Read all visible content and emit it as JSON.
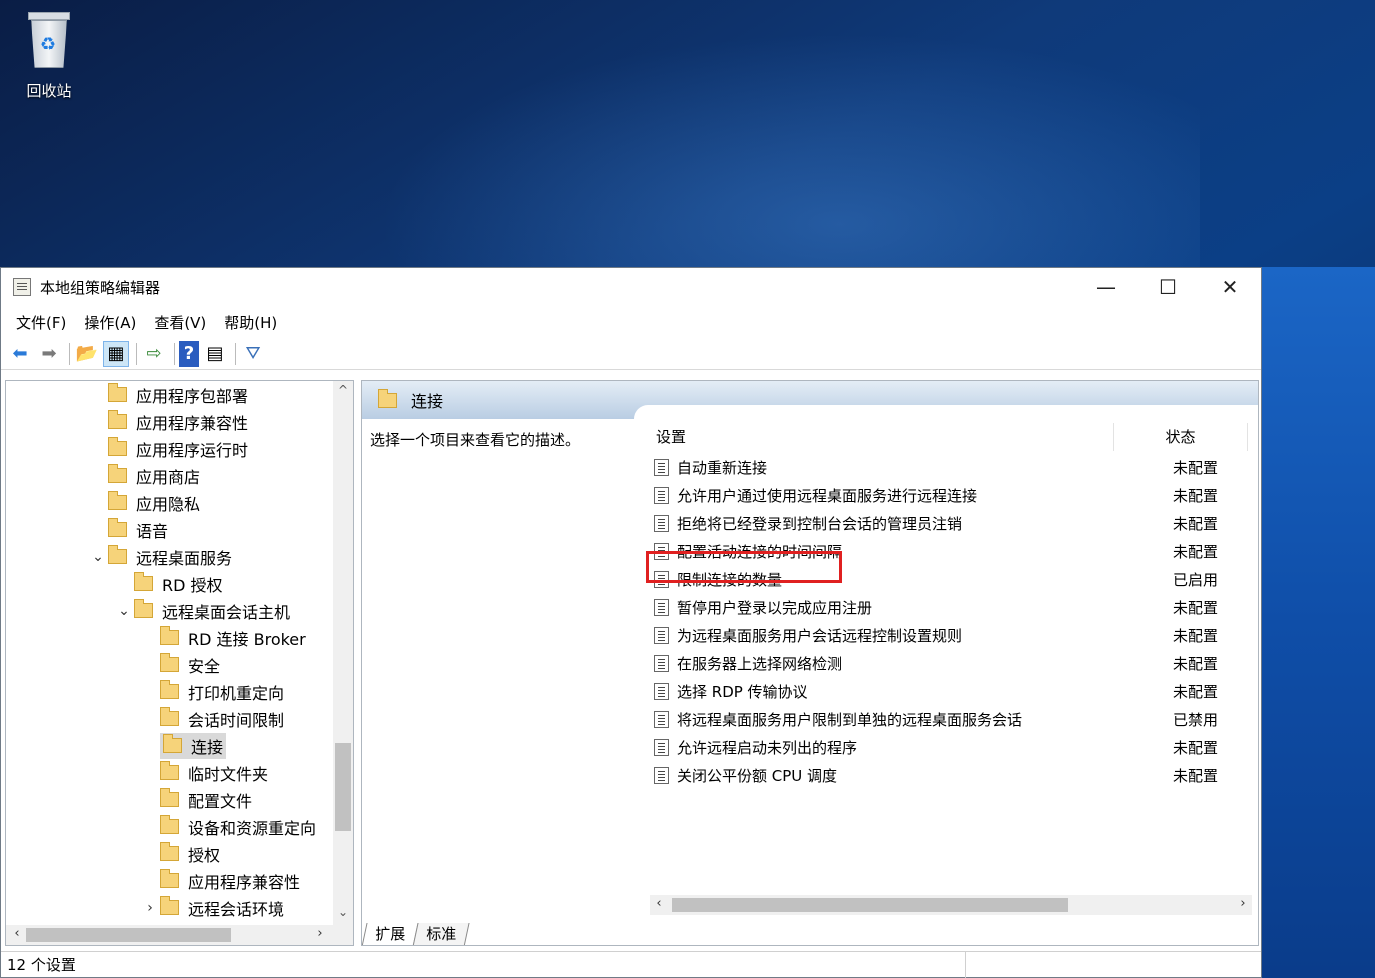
{
  "desktop": {
    "recycle_bin_label": "回收站"
  },
  "window": {
    "title": "本地组策略编辑器",
    "controls": {
      "minimize": "—",
      "maximize": "☐",
      "close": "✕"
    }
  },
  "menu": [
    "文件(F)",
    "操作(A)",
    "查看(V)",
    "帮助(H)"
  ],
  "toolbar": {
    "icons": [
      "back-arrow-icon",
      "forward-arrow-icon",
      "up-folder-icon",
      "show-hide-tree-icon",
      "export-list-icon",
      "help-icon",
      "properties-icon",
      "filter-icon"
    ],
    "glyphs": {
      "back": "⬅",
      "forward": "➡",
      "up": "📂",
      "tree": "▦",
      "export": "⇨",
      "help": "?",
      "view": "▤",
      "filter": "⛛"
    }
  },
  "tree": {
    "items": [
      {
        "label": "应用程序包部署",
        "level": 0,
        "expander": ""
      },
      {
        "label": "应用程序兼容性",
        "level": 0,
        "expander": ""
      },
      {
        "label": "应用程序运行时",
        "level": 0,
        "expander": ""
      },
      {
        "label": "应用商店",
        "level": 0,
        "expander": ""
      },
      {
        "label": "应用隐私",
        "level": 0,
        "expander": ""
      },
      {
        "label": "语音",
        "level": 0,
        "expander": ""
      },
      {
        "label": "远程桌面服务",
        "level": 0,
        "expander": "⌄"
      },
      {
        "label": "RD 授权",
        "level": 1,
        "expander": ""
      },
      {
        "label": "远程桌面会话主机",
        "level": 1,
        "expander": "⌄"
      },
      {
        "label": "RD 连接 Broker",
        "level": 2,
        "expander": ""
      },
      {
        "label": "安全",
        "level": 2,
        "expander": ""
      },
      {
        "label": "打印机重定向",
        "level": 2,
        "expander": ""
      },
      {
        "label": "会话时间限制",
        "level": 2,
        "expander": ""
      },
      {
        "label": "连接",
        "level": 2,
        "expander": "",
        "selected": true
      },
      {
        "label": "临时文件夹",
        "level": 2,
        "expander": ""
      },
      {
        "label": "配置文件",
        "level": 2,
        "expander": ""
      },
      {
        "label": "设备和资源重定向",
        "level": 2,
        "expander": ""
      },
      {
        "label": "授权",
        "level": 2,
        "expander": ""
      },
      {
        "label": "应用程序兼容性",
        "level": 2,
        "expander": ""
      },
      {
        "label": "远程会话环境",
        "level": 2,
        "expander": "›"
      }
    ],
    "scroll": {
      "up": "^",
      "down": "⌄",
      "left": "‹",
      "right": "›"
    }
  },
  "details": {
    "header": "连接",
    "description": "选择一个项目来查看它的描述。",
    "columns": {
      "setting": "设置",
      "state": "状态"
    },
    "rows": [
      {
        "name": "自动重新连接",
        "state": "未配置"
      },
      {
        "name": "允许用户通过使用远程桌面服务进行远程连接",
        "state": "未配置"
      },
      {
        "name": "拒绝将已经登录到控制台会话的管理员注销",
        "state": "未配置"
      },
      {
        "name": "配置活动连接的时间间隔",
        "state": "未配置"
      },
      {
        "name": "限制连接的数量",
        "state": "已启用",
        "highlighted": true
      },
      {
        "name": "暂停用户登录以完成应用注册",
        "state": "未配置"
      },
      {
        "name": "为远程桌面服务用户会话远程控制设置规则",
        "state": "未配置"
      },
      {
        "name": "在服务器上选择网络检测",
        "state": "未配置"
      },
      {
        "name": "选择 RDP 传输协议",
        "state": "未配置"
      },
      {
        "name": "将远程桌面服务用户限制到单独的远程桌面服务会话",
        "state": "已禁用"
      },
      {
        "name": "允许远程启动未列出的程序",
        "state": "未配置"
      },
      {
        "name": "关闭公平份额 CPU 调度",
        "state": "未配置"
      }
    ],
    "tabs": [
      "扩展",
      "标准"
    ],
    "scroll": {
      "left": "‹",
      "right": "›"
    }
  },
  "status": {
    "text": "12 个设置"
  },
  "colors": {
    "highlight_box": "#e02020",
    "selected_tree": "#d9d9d9"
  }
}
